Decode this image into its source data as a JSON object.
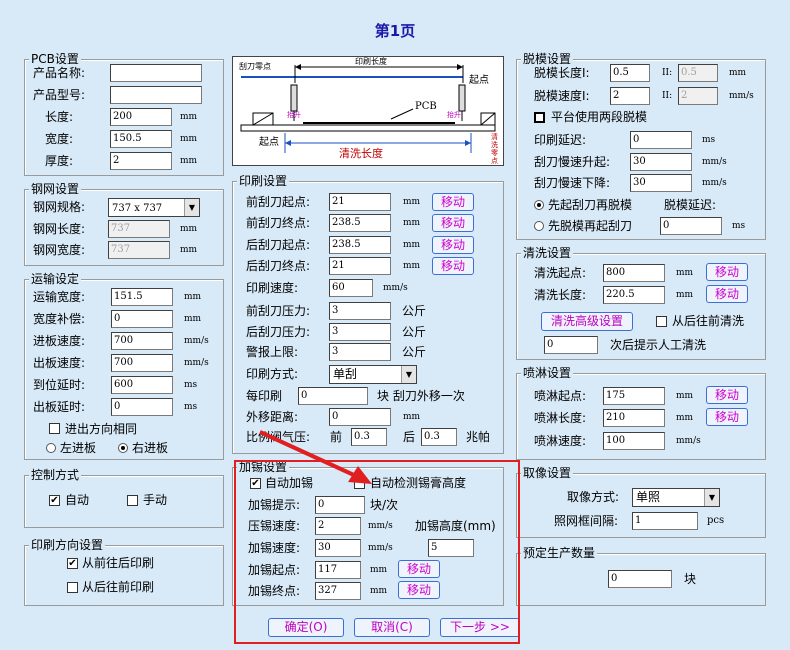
{
  "title": "第1页",
  "pcb": {
    "legend": "PCB设置",
    "name_label": "产品名称:",
    "name_value": "",
    "model_label": "产品型号:",
    "model_value": "",
    "length_label": "长度:",
    "length_value": "200",
    "width_label": "宽度:",
    "width_value": "150.5",
    "thickness_label": "厚度:",
    "thickness_value": "2",
    "unit": "mm"
  },
  "stencil": {
    "legend": "钢网设置",
    "spec_label": "钢网规格:",
    "spec_value": "737 x 737",
    "length_label": "钢网长度:",
    "length_value": "737",
    "width_label": "钢网宽度:",
    "width_value": "737",
    "unit": "mm"
  },
  "transport": {
    "legend": "运输设定",
    "width_label": "运输宽度:",
    "width_value": "151.5",
    "width_unit": "mm",
    "comp_label": "宽度补偿:",
    "comp_value": "0",
    "comp_unit": "mm",
    "in_speed_label": "进板速度:",
    "in_speed_value": "700",
    "in_speed_unit": "mm/s",
    "out_speed_label": "出板速度:",
    "out_speed_value": "700",
    "out_speed_unit": "mm/s",
    "arrive_label": "到位延时:",
    "arrive_value": "600",
    "arrive_unit": "ms",
    "out_delay_label": "出板延时:",
    "out_delay_value": "0",
    "out_delay_unit": "ms",
    "same_dir_label": "进出方向相同",
    "left_in_label": "左进板",
    "right_in_label": "右进板"
  },
  "control": {
    "legend": "控制方式",
    "auto_label": "自动",
    "manual_label": "手动"
  },
  "print_dir": {
    "legend": "印刷方向设置",
    "front_back_label": "从前往后印刷",
    "back_front_label": "从后往前印刷"
  },
  "diagram": {
    "scraper_start": "刮刀零点",
    "print_length": "印刷长度",
    "start_point_right": "起点",
    "pcb": "PCB",
    "clean_length": "清洗长度",
    "start_point_left": "起点",
    "lift_left": "抬升",
    "lift_right": "抬升",
    "right_vertical": "清洗零点"
  },
  "print": {
    "legend": "印刷设置",
    "front_start_label": "前刮刀起点:",
    "front_start_value": "21",
    "front_end_label": "前刮刀终点:",
    "front_end_value": "238.5",
    "rear_start_label": "后刮刀起点:",
    "rear_start_value": "238.5",
    "rear_end_label": "后刮刀终点:",
    "rear_end_value": "21",
    "unit": "mm",
    "move_label": "移动",
    "speed_label": "印刷速度:",
    "speed_value": "60",
    "speed_unit": "mm/s",
    "front_pressure_label": "前刮刀压力:",
    "front_pressure_value": "3",
    "rear_pressure_label": "后刮刀压力:",
    "rear_pressure_value": "3",
    "alarm_label": "警报上限:",
    "alarm_value": "3",
    "pressure_unit": "公斤",
    "mode_label": "印刷方式:",
    "mode_value": "单刮",
    "each_label": "每印刷",
    "each_value": "0",
    "each_suffix": "块 刮刀外移一次",
    "shift_label": "外移距离:",
    "shift_value": "0",
    "shift_unit": "mm",
    "valve_label": "比例阀气压:",
    "valve_front_label": "前",
    "valve_front_value": "0.3",
    "valve_rear_label": "后",
    "valve_rear_value": "0.3",
    "valve_unit": "兆帕"
  },
  "solder": {
    "legend": "加锡设置",
    "auto_add_label": "自动加锡",
    "auto_detect_label": "自动检测锡膏高度",
    "prompt_label": "加锡提示:",
    "prompt_value": "0",
    "prompt_unit": "块/次",
    "press_speed_label": "压锡速度:",
    "press_speed_value": "2",
    "press_speed_unit": "mm/s",
    "height_label": "加锡高度(mm)",
    "height_value": "5",
    "add_speed_label": "加锡速度:",
    "add_speed_value": "30",
    "add_speed_unit": "mm/s",
    "start_label": "加锡起点:",
    "start_value": "117",
    "end_label": "加锡终点:",
    "end_value": "327",
    "unit": "mm",
    "move_label": "移动"
  },
  "demold": {
    "legend": "脱模设置",
    "length_label": "脱模长度I:",
    "length_value": "0.5",
    "length2_label": "II:",
    "length2_value": "0.5",
    "length_unit": "mm",
    "speed_label": "脱模速度I:",
    "speed_value": "2",
    "speed2_label": "II:",
    "speed2_value": "2",
    "speed_unit": "mm/s",
    "platform_label": "平台使用两段脱模",
    "print_delay_label": "印刷延迟:",
    "print_delay_value": "0",
    "print_delay_unit": "ms",
    "slow_up_label": "刮刀慢速升起:",
    "slow_up_value": "30",
    "slow_up_unit": "mm/s",
    "slow_down_label": "刮刀慢速下降:",
    "slow_down_value": "30",
    "slow_down_unit": "mm/s",
    "opt1_label": "先起刮刀再脱模",
    "delay_label": "脱模延迟:",
    "opt2_label": "先脱模再起刮刀",
    "delay_value": "0",
    "delay_unit": "ms"
  },
  "clean": {
    "legend": "清洗设置",
    "start_label": "清洗起点:",
    "start_value": "800",
    "length_label": "清洗长度:",
    "length_value": "220.5",
    "unit": "mm",
    "move_label": "移动",
    "advanced_label": "清洗高级设置",
    "back_front_label": "从后往前清洗",
    "prompt_value": "0",
    "prompt_suffix": "次后提示人工清洗"
  },
  "spray": {
    "legend": "喷淋设置",
    "start_label": "喷淋起点:",
    "start_value": "175",
    "length_label": "喷淋长度:",
    "length_value": "210",
    "speed_label": "喷淋速度:",
    "speed_value": "100",
    "unit": "mm",
    "speed_unit": "mm/s",
    "move_label": "移动"
  },
  "capture": {
    "legend": "取像设置",
    "mode_label": "取像方式:",
    "mode_value": "单照",
    "interval_label": "照网框间隔:",
    "interval_value": "1",
    "interval_unit": "pcs"
  },
  "production": {
    "legend": "预定生产数量",
    "value": "0",
    "unit": "块"
  },
  "buttons": {
    "ok": "确定(O)",
    "cancel": "取消(C)",
    "next": "下一步 >>"
  },
  "colors": {
    "highlight_box": "#e02020",
    "arrow": "#e02020",
    "move_text": "#d000d0"
  }
}
